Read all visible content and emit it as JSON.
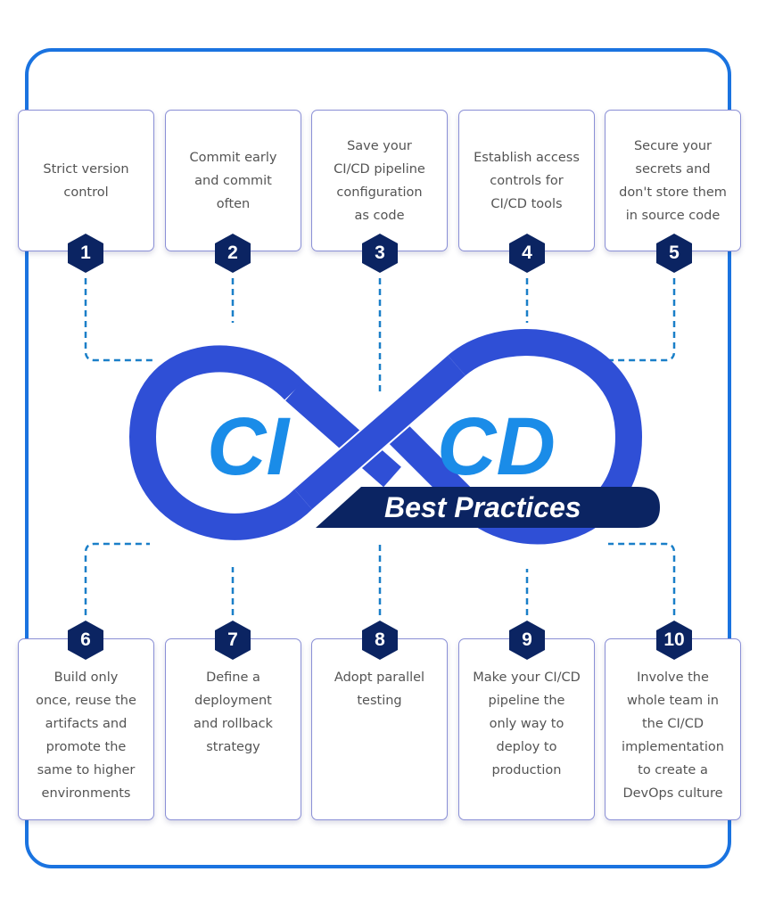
{
  "logo": {
    "ci": "CI",
    "cd": "CD",
    "subtitle": "Best Practices"
  },
  "colors": {
    "frame": "#1a73e0",
    "infinity": "#2f4fd6",
    "ci_cd_text": "#1a8ce8",
    "banner": "#0b2462",
    "hex": "#0b2462",
    "connector": "#1a7fc8",
    "card_border": "#8a8fd6",
    "card_text": "#545454"
  },
  "practices": [
    {
      "number": "1",
      "lines": [
        "Strict version",
        "control"
      ]
    },
    {
      "number": "2",
      "lines": [
        "Commit early",
        "and commit",
        "often"
      ]
    },
    {
      "number": "3",
      "lines": [
        "Save your",
        "CI/CD pipeline",
        "configuration",
        "as code"
      ]
    },
    {
      "number": "4",
      "lines": [
        "Establish access",
        "controls for",
        "CI/CD tools"
      ]
    },
    {
      "number": "5",
      "lines": [
        "Secure your",
        "secrets and",
        "don't store them",
        "in source code"
      ]
    },
    {
      "number": "6",
      "lines": [
        "Build only",
        "once, reuse the",
        "artifacts and",
        "promote the",
        "same to higher",
        "environments"
      ]
    },
    {
      "number": "7",
      "lines": [
        "Define a",
        "deployment",
        "and rollback",
        "strategy"
      ]
    },
    {
      "number": "8",
      "lines": [
        "Adopt parallel",
        "testing"
      ]
    },
    {
      "number": "9",
      "lines": [
        "Make your CI/CD",
        "pipeline the",
        "only way to",
        "deploy to",
        "production"
      ]
    },
    {
      "number": "10",
      "lines": [
        "Involve the",
        "whole team in",
        "the CI/CD",
        "implementation",
        "to create a",
        "DevOps culture"
      ]
    }
  ]
}
